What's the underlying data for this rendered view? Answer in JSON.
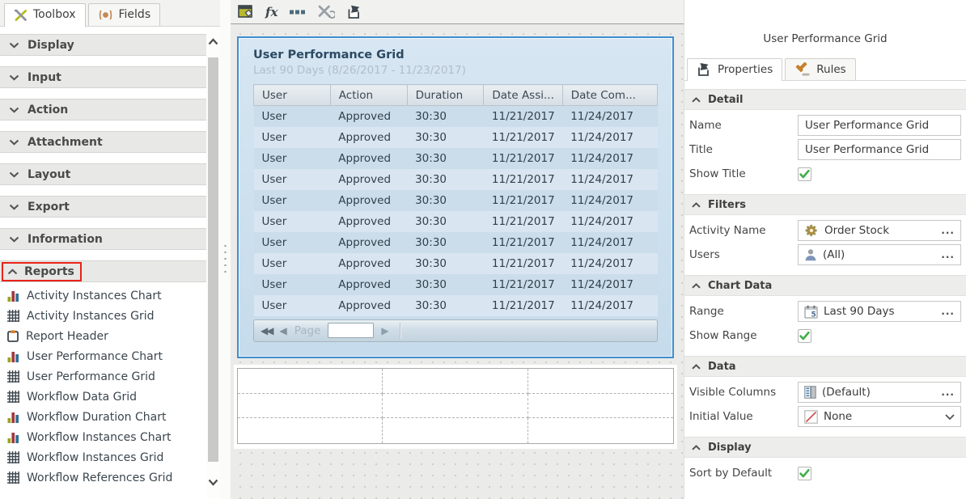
{
  "colors": {
    "selection_blue": "#3e8ed0",
    "highlight_red": "#e8231a",
    "check_green": "#3fae49"
  },
  "left_panel": {
    "tabs": [
      {
        "label": "Toolbox"
      },
      {
        "label": "Fields"
      }
    ],
    "collapsed_sections": [
      "Display",
      "Input",
      "Action",
      "Attachment",
      "Layout",
      "Export",
      "Information"
    ],
    "reports_section": {
      "label": "Reports",
      "highlighted": true,
      "items": [
        {
          "icon": "bar-chart-icon",
          "label": "Activity Instances Chart"
        },
        {
          "icon": "grid-icon",
          "label": "Activity Instances Grid"
        },
        {
          "icon": "report-header-icon",
          "label": "Report Header"
        },
        {
          "icon": "bar-chart-icon",
          "label": "User Performance Chart"
        },
        {
          "icon": "grid-icon",
          "label": "User Performance Grid"
        },
        {
          "icon": "grid-icon",
          "label": "Workflow Data Grid"
        },
        {
          "icon": "bar-chart-icon",
          "label": "Workflow Duration Chart"
        },
        {
          "icon": "bar-chart-icon",
          "label": "Workflow Instances Chart"
        },
        {
          "icon": "grid-icon",
          "label": "Workflow Instances Grid"
        },
        {
          "icon": "grid-icon",
          "label": "Workflow References Grid"
        }
      ]
    }
  },
  "canvas": {
    "toolbar": {
      "fx_label": "fx"
    },
    "widget": {
      "title": "User Performance Grid",
      "subtitle": "Last 90 Days (8/26/2017 - 11/23/2017)",
      "columns": [
        "User",
        "Action",
        "Duration",
        "Date Assi...",
        "Date Com..."
      ],
      "rows": [
        [
          "User",
          "Approved",
          "30:30",
          "11/21/2017",
          "11/24/2017"
        ],
        [
          "User",
          "Approved",
          "30:30",
          "11/21/2017",
          "11/24/2017"
        ],
        [
          "User",
          "Approved",
          "30:30",
          "11/21/2017",
          "11/24/2017"
        ],
        [
          "User",
          "Approved",
          "30:30",
          "11/21/2017",
          "11/24/2017"
        ],
        [
          "User",
          "Approved",
          "30:30",
          "11/21/2017",
          "11/24/2017"
        ],
        [
          "User",
          "Approved",
          "30:30",
          "11/21/2017",
          "11/24/2017"
        ],
        [
          "User",
          "Approved",
          "30:30",
          "11/21/2017",
          "11/24/2017"
        ],
        [
          "User",
          "Approved",
          "30:30",
          "11/21/2017",
          "11/24/2017"
        ],
        [
          "User",
          "Approved",
          "30:30",
          "11/21/2017",
          "11/24/2017"
        ],
        [
          "User",
          "Approved",
          "30:30",
          "11/21/2017",
          "11/24/2017"
        ]
      ],
      "pager": {
        "first": "◀◀",
        "prev": "◀",
        "label": "Page",
        "page_value": "",
        "next": "▶"
      }
    }
  },
  "right_panel": {
    "widget_title": "User Performance Grid",
    "tabs": [
      {
        "label": "Properties",
        "icon": "tag-icon",
        "active": true
      },
      {
        "label": "Rules",
        "icon": "gavel-icon",
        "active": false
      }
    ],
    "sections": [
      {
        "title": "Detail",
        "rows": [
          {
            "label": "Name",
            "type": "text-input",
            "value": "User Performance Grid",
            "name": "name-field"
          },
          {
            "label": "Title",
            "type": "text-input",
            "value": "User Performance Grid",
            "name": "title-field"
          },
          {
            "label": "Show Title",
            "type": "checkbox",
            "checked": true,
            "name": "show-title-checkbox"
          }
        ]
      },
      {
        "title": "Filters",
        "rows": [
          {
            "label": "Activity Name",
            "type": "picker",
            "icon": "gear-icon",
            "value": "Order Stock",
            "ellipsis": "...",
            "name": "activity-name-picker"
          },
          {
            "label": "Users",
            "type": "picker",
            "icon": "user-icon",
            "value": "(All)",
            "ellipsis": "...",
            "name": "users-picker"
          }
        ]
      },
      {
        "title": "Chart Data",
        "rows": [
          {
            "label": "Range",
            "type": "picker",
            "icon": "calendar-icon",
            "value": "Last 90 Days",
            "ellipsis": "...",
            "name": "range-picker"
          },
          {
            "label": "Show Range",
            "type": "checkbox",
            "checked": true,
            "name": "show-range-checkbox"
          }
        ]
      },
      {
        "title": "Data",
        "rows": [
          {
            "label": "Visible Columns",
            "type": "picker",
            "icon": "columns-icon",
            "value": "(Default)",
            "ellipsis": "...",
            "name": "visible-columns-picker"
          },
          {
            "label": "Initial Value",
            "type": "dropdown",
            "icon": "none-icon",
            "value": "None",
            "name": "initial-value-dropdown"
          }
        ]
      },
      {
        "title": "Display",
        "rows": [
          {
            "label": "Sort by Default",
            "type": "checkbox",
            "checked": true,
            "name": "sort-by-default-checkbox"
          }
        ]
      }
    ]
  }
}
